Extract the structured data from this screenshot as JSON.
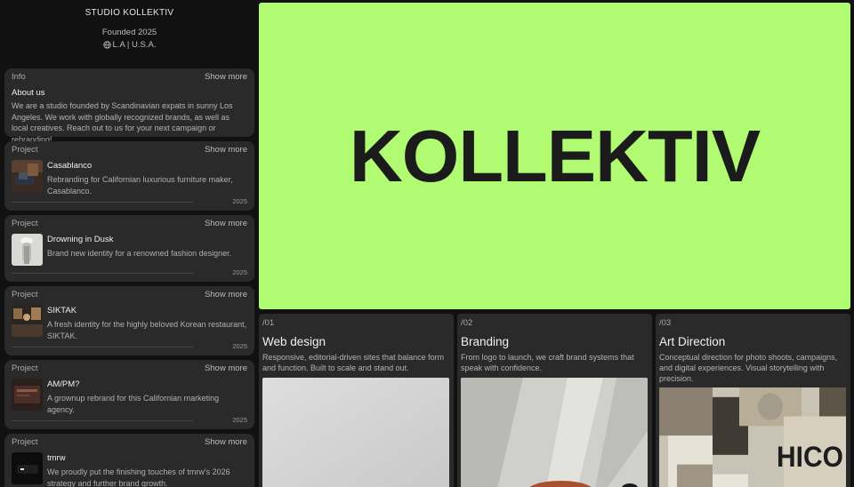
{
  "studio": {
    "name": "STUDIO KOLLEKTIV",
    "founded": "Founded 2025",
    "location": "L.A | U.S.A."
  },
  "info_card": {
    "label": "Info",
    "show_more": "Show more",
    "title": "About us",
    "text": "We are a studio founded by Scandinavian expats in sunny Los Angeles. We work with globally recognized brands, as well as local creatives. Reach out to us for your next campaign or rebranding!"
  },
  "projects": [
    {
      "label": "Project",
      "show_more": "Show more",
      "name": "Casablanco",
      "desc": "Rebranding for Californian luxurious furniture maker, Casablanco.",
      "year": "2025",
      "thumb": "furniture-interior"
    },
    {
      "label": "Project",
      "show_more": "Show more",
      "name": "Drowning in Dusk",
      "desc": "Brand new identity for a renowned fashion designer.",
      "year": "2025",
      "thumb": "fashion-portrait"
    },
    {
      "label": "Project",
      "show_more": "Show more",
      "name": "SIKTAK",
      "desc": "A fresh identity for the highly beloved Korean restaurant, SIKTAK.",
      "year": "2025",
      "thumb": "restaurant-interior"
    },
    {
      "label": "Project",
      "show_more": "Show more",
      "name": "AM/PM?",
      "desc": "A grownup rebrand for this Californian marketing agency.",
      "year": "2025",
      "thumb": "dark-product"
    },
    {
      "label": "Project",
      "show_more": "Show more",
      "name": "tmrw",
      "desc": "We proudly put the finishing touches of tmrw's 2026 strategy and further brand growth.",
      "year": "",
      "thumb": "dark-device"
    }
  ],
  "hero": {
    "wordmark": "KOLLEKTIV",
    "color": "#b0fb72"
  },
  "services": [
    {
      "num": "/01",
      "title": "Web design",
      "desc": "Responsive, editorial-driven sites that balance form and function. Built to scale and stand out."
    },
    {
      "num": "/02",
      "title": "Branding",
      "desc": "From logo to launch, we craft brand systems that speak with confidence."
    },
    {
      "num": "/03",
      "title": "Art Direction",
      "desc": "Conceptual direction for photo shoots, campaigns, and digital experiences. Visual storytelling with precision."
    }
  ],
  "poster_text": "HICO"
}
